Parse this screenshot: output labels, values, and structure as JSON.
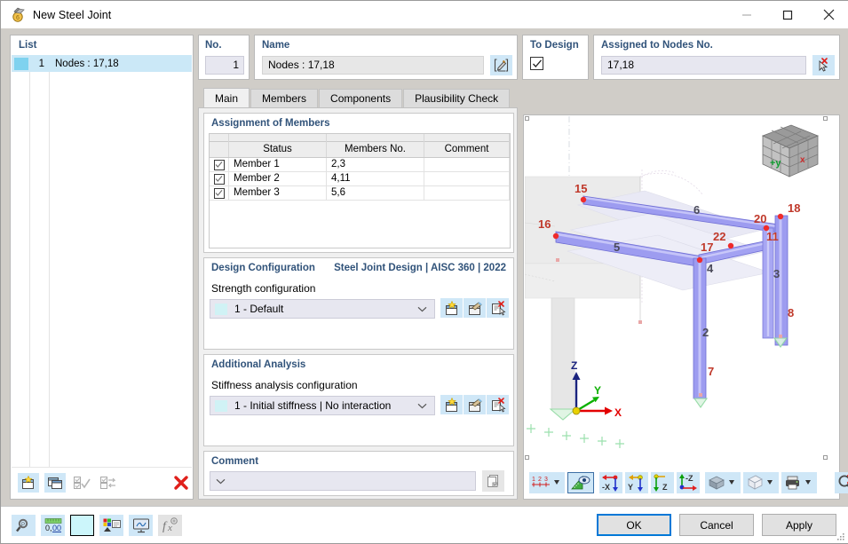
{
  "window": {
    "title": "New Steel Joint",
    "icon": "steel-joint-icon",
    "minimize": "—",
    "maximize": "□",
    "close": "✕"
  },
  "list_panel": {
    "label": "List",
    "rows": [
      {
        "no": "1",
        "name": "Nodes : 17,18",
        "color": "#7fd2ef",
        "selected": true
      }
    ],
    "toolbar": [
      {
        "name": "new-item-button",
        "icon": "new-window-star-icon"
      },
      {
        "name": "copy-item-button",
        "icon": "copy-window-icon"
      },
      {
        "name": "select-all-button",
        "icon": "check-all-icon",
        "disabled": true
      },
      {
        "name": "invert-selection-button",
        "icon": "invert-selection-icon",
        "disabled": true
      },
      {
        "name": "delete-item-button",
        "icon": "red-x-icon"
      }
    ]
  },
  "no_field": {
    "label": "No.",
    "value": "1"
  },
  "name_field": {
    "label": "Name",
    "value": "Nodes : 17,18",
    "edit_button_icon": "edit-pencil-icon"
  },
  "to_design": {
    "label": "To Design",
    "checked": true
  },
  "assigned_nodes": {
    "label": "Assigned to Nodes No.",
    "value": "17,18",
    "pick_button_icon": "pick-cursor-icon"
  },
  "tabs": [
    {
      "label": "Main",
      "active": true
    },
    {
      "label": "Members",
      "active": false
    },
    {
      "label": "Components",
      "active": false
    },
    {
      "label": "Plausibility Check",
      "active": false
    }
  ],
  "assignment": {
    "title": "Assignment of Members",
    "columns": [
      "",
      "Status",
      "Members No.",
      "Comment"
    ],
    "rows": [
      {
        "checked": true,
        "status": "Member 1",
        "members_no": "2,3",
        "comment": ""
      },
      {
        "checked": true,
        "status": "Member 2",
        "members_no": "4,11",
        "comment": ""
      },
      {
        "checked": true,
        "status": "Member 3",
        "members_no": "5,6",
        "comment": ""
      }
    ]
  },
  "design_configuration": {
    "title": "Design Configuration",
    "standard": "Steel Joint Design | AISC 360 | 2022",
    "field_label": "Strength configuration",
    "value": "1 - Default",
    "swatch": "#d0f2f5",
    "buttons": [
      {
        "name": "new-configuration-button",
        "icon": "new-config-star-icon"
      },
      {
        "name": "edit-configuration-button",
        "icon": "edit-config-icon"
      },
      {
        "name": "delete-configuration-button",
        "icon": "delete-config-icon"
      }
    ]
  },
  "additional_analysis": {
    "title": "Additional Analysis",
    "field_label": "Stiffness analysis configuration",
    "value": "1 - Initial stiffness | No interaction",
    "swatch": "#d0f2f5",
    "buttons": [
      {
        "name": "new-stiffness-configuration-button",
        "icon": "new-config-star-icon"
      },
      {
        "name": "edit-stiffness-configuration-button",
        "icon": "edit-config-icon"
      },
      {
        "name": "delete-stiffness-configuration-button",
        "icon": "delete-config-icon"
      }
    ]
  },
  "comment": {
    "title": "Comment",
    "value": "",
    "placeholder": "",
    "button_icon": "copy-pages-icon"
  },
  "viewport": {
    "view_cube_label": "+y",
    "axes": {
      "x": "X",
      "y": "Y",
      "z": "Z"
    },
    "node_labels": [
      "15",
      "16",
      "18",
      "20",
      "11",
      "22",
      "17"
    ],
    "member_labels": [
      "6",
      "5",
      "4",
      "2",
      "3",
      "7",
      "8"
    ],
    "toolbar": [
      {
        "name": "numbering-button",
        "icon": "numbering-123-icon",
        "dropdown": true
      },
      {
        "name": "render-mode-button",
        "icon": "ruler-eye-icon",
        "selected": true
      },
      {
        "name": "view-x-button",
        "icon": "view-minus-x-icon",
        "label": "-X"
      },
      {
        "name": "view-y-button",
        "icon": "view-y-icon",
        "label": "Y"
      },
      {
        "name": "view-z-button",
        "icon": "view-z-icon",
        "label": "Z"
      },
      {
        "name": "view-minus-z-button",
        "icon": "view-minus-z-icon",
        "label": "-Z"
      },
      {
        "name": "display-style-button",
        "icon": "solid-blocks-icon",
        "dropdown": true
      },
      {
        "name": "wireframe-button",
        "icon": "wireframe-cube-icon",
        "dropdown": true
      },
      {
        "name": "print-button",
        "icon": "printer-icon",
        "dropdown": true
      },
      {
        "name": "zoom-reset-button",
        "icon": "zoom-cancel-icon"
      }
    ]
  },
  "bottom_bar": {
    "tools": [
      {
        "name": "search-tool-button",
        "icon": "magnifier-icon"
      },
      {
        "name": "units-button",
        "icon": "units-000-icon"
      },
      {
        "name": "color-swatch-button",
        "icon": "color-swatch-icon",
        "color": "#ccf6fb"
      },
      {
        "name": "display-properties-button",
        "icon": "color-legend-icon"
      },
      {
        "name": "graphic-settings-button",
        "icon": "monitor-icon"
      },
      {
        "name": "formula-button",
        "icon": "function-fx-icon",
        "disabled": true
      }
    ],
    "buttons": [
      {
        "label": "OK",
        "name": "ok-button",
        "default": true
      },
      {
        "label": "Cancel",
        "name": "cancel-button",
        "default": false
      },
      {
        "label": "Apply",
        "name": "apply-button",
        "default": false
      }
    ]
  }
}
